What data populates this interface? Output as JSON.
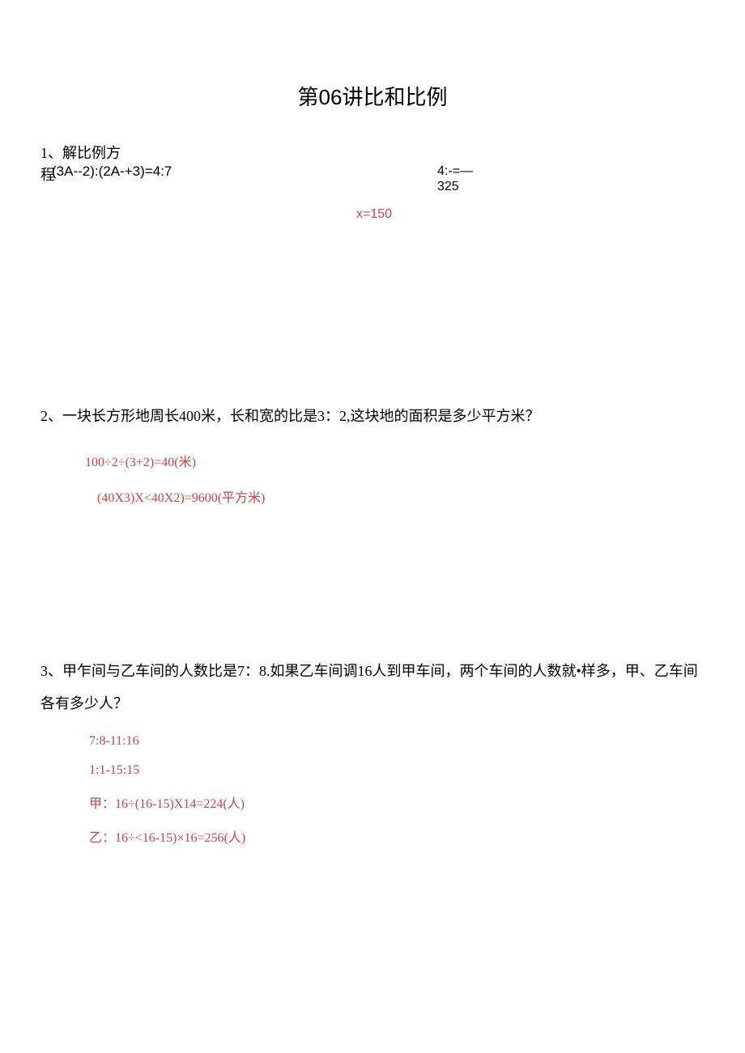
{
  "title": "第06讲比和比例",
  "q1": {
    "line1": "1、解比例方",
    "line2_prefix": "程",
    "equation_left": "(3A--2):(2A-+3)=4:7",
    "right_top": "4:-=—",
    "right_bottom": "325",
    "answer": "x=150"
  },
  "q2": {
    "header": "2、一块长方形地周长400米，长和宽的比是3：2,这块地的面积是多少平方米？",
    "ans1": "100÷2÷(3+2)=40(米)",
    "ans2": "(40X3)X<40X2)=9600(平方米)"
  },
  "q3": {
    "header": "3、甲乍间与乙车间的人数比是7：8.如果乙车间调16人到甲车间，两个车间的人数就•样多，甲、乙车间各有多少人？",
    "ans1": "7:8-11:16",
    "ans2": "1:1-15:15",
    "ans3": "甲：16÷(16-15)X14=224(人)",
    "ans4": "乙：16÷<16-15)×16=256(人)"
  }
}
